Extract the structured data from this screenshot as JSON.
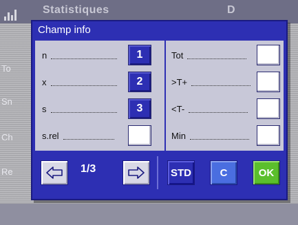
{
  "background": {
    "title": "Statistiques",
    "title_right": "D",
    "side_labels": [
      "To",
      "Sn",
      "Ch",
      "Re"
    ]
  },
  "dialog": {
    "title": "Champ info",
    "left_items": [
      {
        "label": "n",
        "value": "1",
        "active": true
      },
      {
        "label": "x",
        "value": "2",
        "active": true
      },
      {
        "label": "s",
        "value": "3",
        "active": true
      },
      {
        "label": "s.rel",
        "value": "",
        "active": false
      }
    ],
    "right_items": [
      {
        "label": "Tot",
        "value": "",
        "active": false
      },
      {
        "label": ">T+",
        "value": "",
        "active": false
      },
      {
        "label": "<T-",
        "value": "",
        "active": false
      },
      {
        "label": "Min",
        "value": "",
        "active": false
      }
    ],
    "footer": {
      "prev_icon": "arrow-left-icon",
      "page": "1/3",
      "next_icon": "arrow-right-icon",
      "std_label": "STD",
      "clear_label": "C",
      "ok_label": "OK"
    }
  },
  "colors": {
    "dialog_blue": "#2d2fb3",
    "ok_green": "#5bbf2c",
    "clear_blue": "#4a6ee0"
  }
}
